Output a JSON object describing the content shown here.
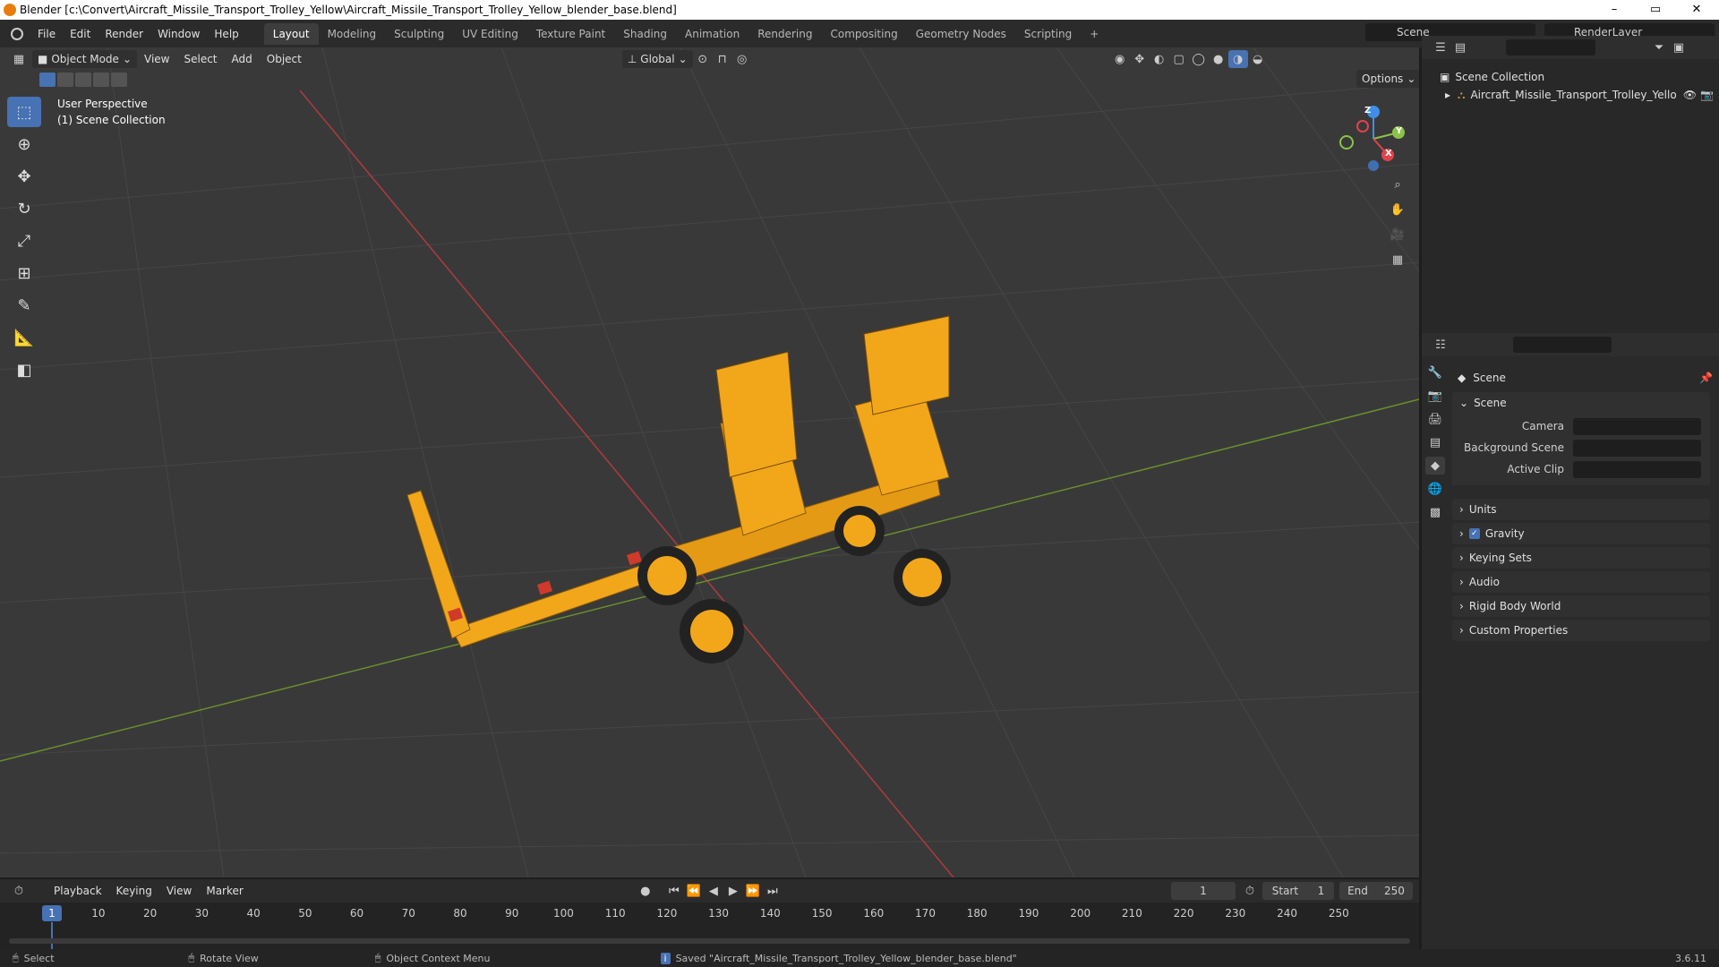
{
  "window": {
    "title": "Blender [c:\\Convert\\Aircraft_Missile_Transport_Trolley_Yellow\\Aircraft_Missile_Transport_Trolley_Yellow_blender_base.blend]",
    "minimize": "–",
    "maximize": "▭",
    "close": "✕"
  },
  "menu": {
    "items": [
      "File",
      "Edit",
      "Render",
      "Window",
      "Help"
    ],
    "workspaces": [
      "Layout",
      "Modeling",
      "Sculpting",
      "UV Editing",
      "Texture Paint",
      "Shading",
      "Animation",
      "Rendering",
      "Compositing",
      "Geometry Nodes",
      "Scripting"
    ],
    "active_workspace": "Layout",
    "add_workspace": "+",
    "scene_label": "Scene",
    "renderlayer_label": "RenderLayer"
  },
  "viewport_header": {
    "mode": "Object Mode",
    "menus": [
      "View",
      "Select",
      "Add",
      "Object"
    ],
    "transform_orientation": "Global",
    "options": "Options"
  },
  "viewport": {
    "perspective": "User Perspective",
    "collection": "(1) Scene Collection",
    "gizmo": {
      "x": "X",
      "y": "Y",
      "z": "Z"
    }
  },
  "outliner": {
    "root": "Scene Collection",
    "object": "Aircraft_Missile_Transport_Trolley_Yello"
  },
  "properties": {
    "title": "Scene",
    "section": "Scene",
    "fields": [
      {
        "label": "Camera",
        "value": ""
      },
      {
        "label": "Background Scene",
        "value": ""
      },
      {
        "label": "Active Clip",
        "value": ""
      }
    ],
    "panels": [
      "Units",
      "Gravity",
      "Keying Sets",
      "Audio",
      "Rigid Body World",
      "Custom Properties"
    ],
    "gravity_checked": true
  },
  "timeline": {
    "menus": [
      "Playback",
      "Keying",
      "View",
      "Marker"
    ],
    "current_frame": "1",
    "start_label": "Start",
    "start": "1",
    "end_label": "End",
    "end": "250",
    "ticks": [
      "1",
      "10",
      "20",
      "30",
      "40",
      "50",
      "60",
      "70",
      "80",
      "90",
      "100",
      "110",
      "120",
      "130",
      "140",
      "150",
      "160",
      "170",
      "180",
      "190",
      "200",
      "210",
      "220",
      "230",
      "240",
      "250"
    ]
  },
  "statusbar": {
    "select": "Select",
    "rotate": "Rotate View",
    "context": "Object Context Menu",
    "message": "Saved \"Aircraft_Missile_Transport_Trolley_Yellow_blender_base.blend\"",
    "version": "3.6.11"
  },
  "colors": {
    "accent": "#4772b3",
    "x_axis": "#e2434b",
    "y_axis": "#8bc34a",
    "z_axis": "#3f8fe8",
    "model": "#f2a71b"
  }
}
